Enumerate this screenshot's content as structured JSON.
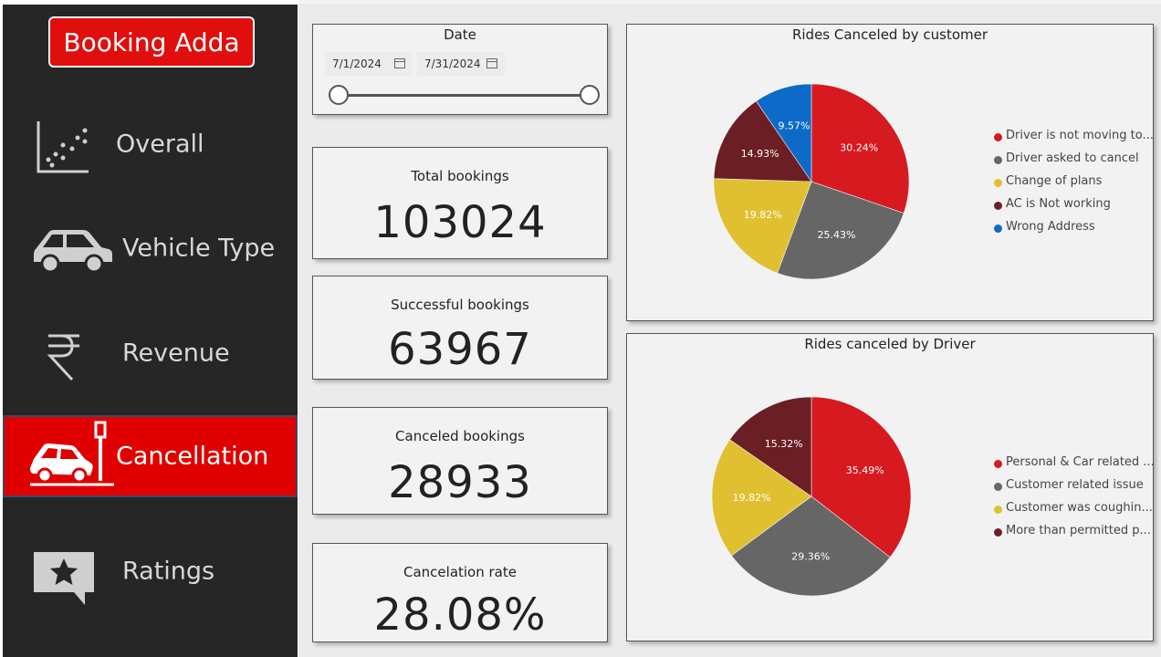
{
  "sidebar": {
    "logo": "Booking Adda",
    "items": [
      {
        "label": "Overall"
      },
      {
        "label": "Vehicle Type"
      },
      {
        "label": "Revenue"
      },
      {
        "label": "Cancellation"
      },
      {
        "label": "Ratings"
      }
    ]
  },
  "date_filter": {
    "title": "Date",
    "start": "7/1/2024",
    "end": "7/31/2024"
  },
  "kpis": [
    {
      "title": "Total bookings",
      "value": "103024"
    },
    {
      "title": "Successful bookings",
      "value": "63967"
    },
    {
      "title": "Canceled bookings",
      "value": "28933"
    },
    {
      "title": "Cancelation rate",
      "value": "28.08%"
    }
  ],
  "chart_data": [
    {
      "type": "pie",
      "title": "Rides Canceled by customer",
      "legend_position": "right",
      "slices": [
        {
          "label": "Driver is not moving to...",
          "value": 30.24,
          "display": "30.24%",
          "color": "#d71920"
        },
        {
          "label": "Driver asked to cancel",
          "value": 25.43,
          "display": "25.43%",
          "color": "#666666"
        },
        {
          "label": "Change of plans",
          "value": 19.82,
          "display": "19.82%",
          "color": "#e0c030"
        },
        {
          "label": "AC is Not working",
          "value": 14.93,
          "display": "14.93%",
          "color": "#6b1f24"
        },
        {
          "label": "Wrong Address",
          "value": 9.57,
          "display": "9.57%",
          "color": "#0e6ac8"
        }
      ]
    },
    {
      "type": "pie",
      "title": "Rides canceled by Driver",
      "legend_position": "right",
      "slices": [
        {
          "label": "Personal & Car related ...",
          "value": 35.49,
          "display": "35.49%",
          "color": "#d71920"
        },
        {
          "label": "Customer related issue",
          "value": 29.36,
          "display": "29.36%",
          "color": "#666666"
        },
        {
          "label": "Customer was coughin...",
          "value": 19.82,
          "display": "19.82%",
          "color": "#e0c030"
        },
        {
          "label": "More than permitted p...",
          "value": 15.32,
          "display": "15.32%",
          "color": "#6b1f24"
        }
      ]
    }
  ]
}
